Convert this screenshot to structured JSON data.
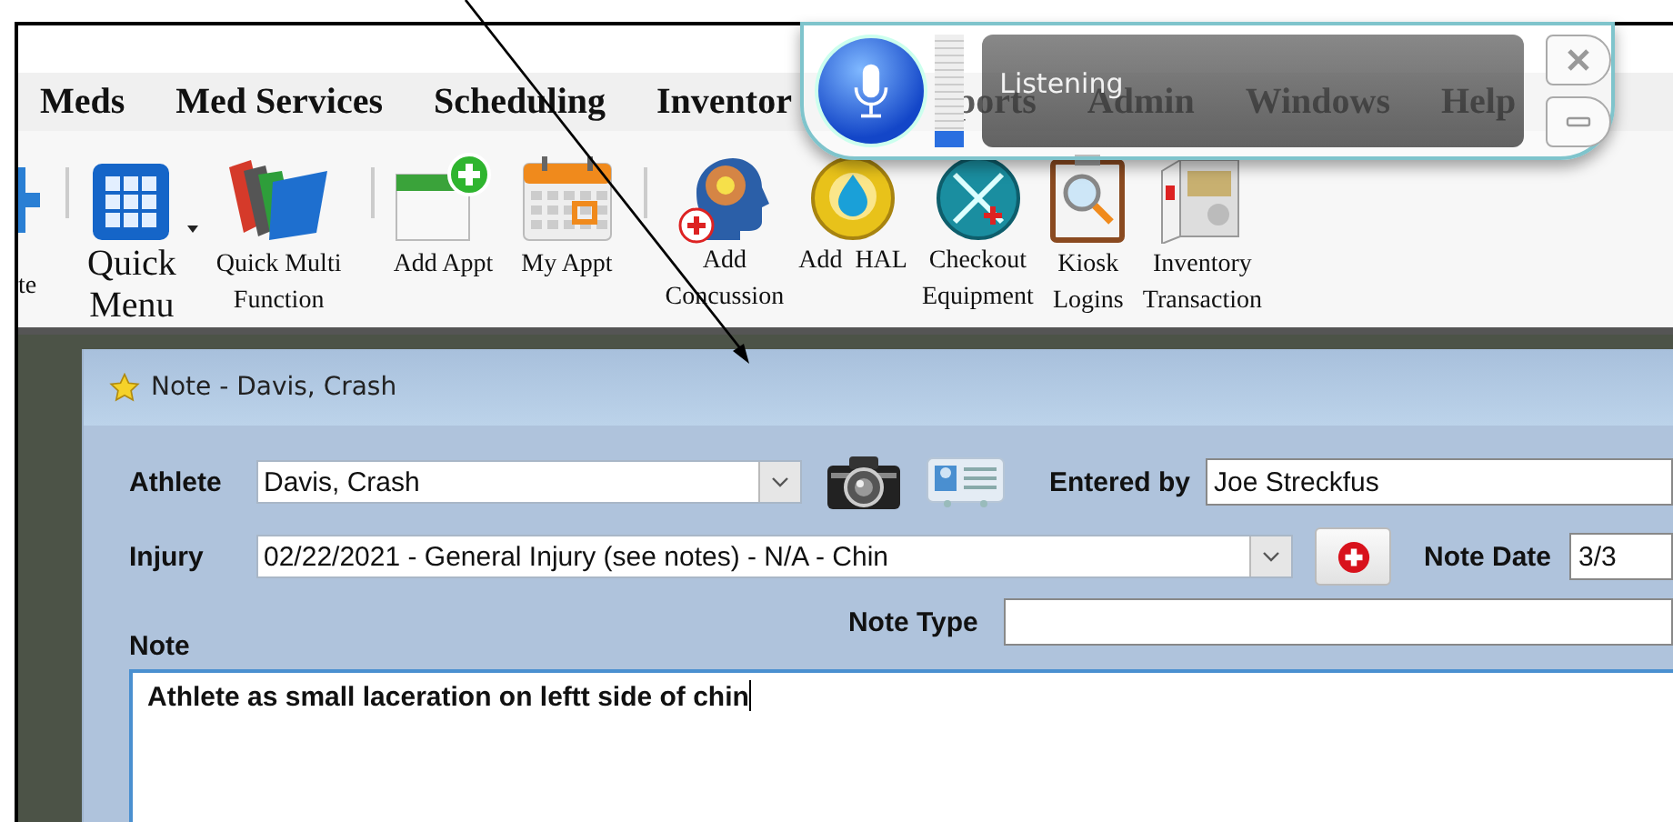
{
  "menu": [
    {
      "label": "Meds"
    },
    {
      "label": "Med Services"
    },
    {
      "label": "Scheduling"
    },
    {
      "label": "Inventor"
    },
    {
      "label": "ports"
    },
    {
      "label": "Admin"
    },
    {
      "label": "Windows"
    },
    {
      "label": "Help"
    }
  ],
  "toolbar": [
    {
      "kind": "plus",
      "label": "te",
      "dropdown": false
    },
    {
      "kind": "separator"
    },
    {
      "kind": "grid",
      "label": "Quick\nMenu",
      "dropdown": true
    },
    {
      "kind": "folders",
      "label": "Quick Multi\nFunction",
      "dropdown": false
    },
    {
      "kind": "separator"
    },
    {
      "kind": "calendar-add",
      "label": "Add Appt",
      "dropdown": false
    },
    {
      "kind": "calendar",
      "label": "My Appt",
      "dropdown": false
    },
    {
      "kind": "separator"
    },
    {
      "kind": "head",
      "label": "Add\nConcussion",
      "dropdown": false
    },
    {
      "kind": "drop",
      "label": "Add  HAL",
      "dropdown": false
    },
    {
      "kind": "tools",
      "label": "Checkout\nEquipment",
      "dropdown": false
    },
    {
      "kind": "clipboard",
      "label": "Kiosk\nLogins",
      "dropdown": false
    },
    {
      "kind": "cabinet",
      "label": "Inventory\nTransaction",
      "dropdown": false
    }
  ],
  "speech": {
    "status": "Listening",
    "level": 0.15
  },
  "note_window": {
    "title": "Note - Davis, Crash",
    "athlete": {
      "label": "Athlete",
      "value": "Davis, Crash"
    },
    "entered_by": {
      "label": "Entered by",
      "value": "Joe Streckfus"
    },
    "injury": {
      "label": "Injury",
      "value": "02/22/2021 - General Injury (see notes) - N/A - Chin"
    },
    "note_date": {
      "label": "Note Date",
      "value": "3/3"
    },
    "note_type": {
      "label": "Note Type"
    },
    "note": {
      "label": "Note",
      "value": "Athlete as small laceration on leftt side of chin"
    }
  }
}
